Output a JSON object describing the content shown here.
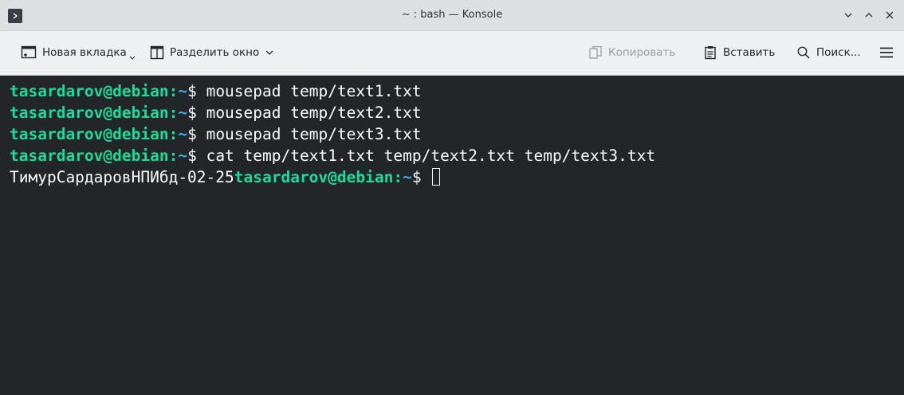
{
  "window": {
    "title": "~ : bash — Konsole"
  },
  "toolbar": {
    "new_tab": "Новая вкладка",
    "split_view": "Разделить окно",
    "copy": "Копировать",
    "paste": "Вставить",
    "search": "Поиск..."
  },
  "terminal": {
    "user_host": "tasardarov@debian",
    "colon": ":",
    "tilde": "~",
    "dollar": "$ ",
    "commands": [
      "mousepad temp/text1.txt",
      "mousepad temp/text2.txt",
      "mousepad temp/text3.txt",
      "cat temp/text1.txt temp/text2.txt temp/text3.txt"
    ],
    "output": "ТимурСардаровНПИбд-02-25"
  },
  "icons": {
    "app": "terminal-app-icon",
    "new_tab": "new-tab-icon",
    "split": "split-view-icon",
    "copy": "copy-icon",
    "paste": "paste-icon",
    "search": "search-icon",
    "menu": "hamburger-menu-icon"
  },
  "colors": {
    "prompt_user": "#1cdc9a",
    "prompt_path": "#3daee9",
    "terminal_bg": "#232629"
  }
}
